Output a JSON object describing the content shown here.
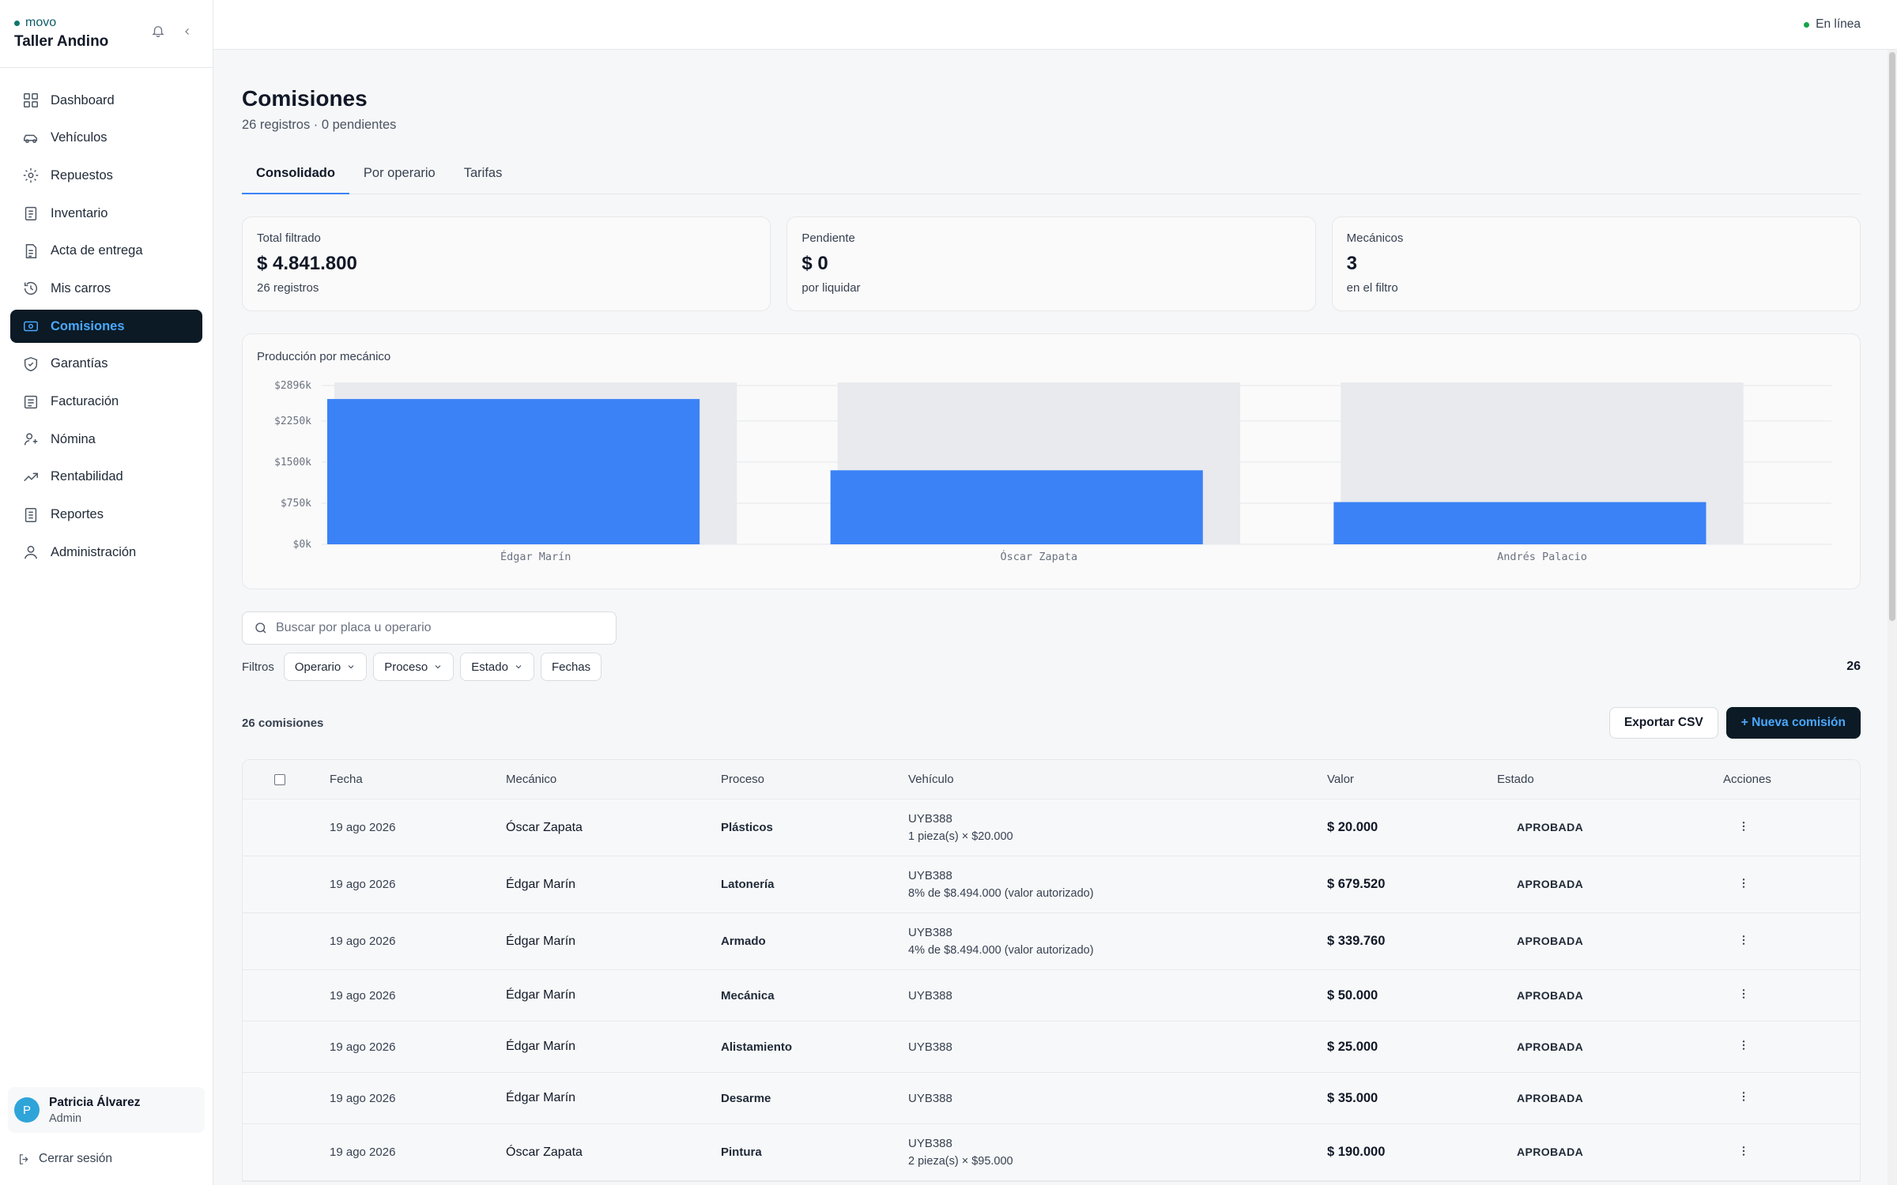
{
  "brand": {
    "small": "movo",
    "name": "Taller Andino"
  },
  "sidebar": {
    "items": [
      {
        "label": "Dashboard",
        "icon": "grid-icon"
      },
      {
        "label": "Vehículos",
        "icon": "car-icon"
      },
      {
        "label": "Repuestos",
        "icon": "gear-icon"
      },
      {
        "label": "Inventario",
        "icon": "clipboard-icon"
      },
      {
        "label": "Acta de entrega",
        "icon": "document-icon"
      },
      {
        "label": "Mis carros",
        "icon": "history-icon"
      },
      {
        "label": "Comisiones",
        "icon": "cash-icon"
      },
      {
        "label": "Garantías",
        "icon": "shield-icon"
      },
      {
        "label": "Facturación",
        "icon": "invoice-icon"
      },
      {
        "label": "Nómina",
        "icon": "user-money-icon"
      },
      {
        "label": "Rentabilidad",
        "icon": "trend-icon"
      },
      {
        "label": "Reportes",
        "icon": "report-icon"
      },
      {
        "label": "Administración",
        "icon": "admin-icon"
      }
    ],
    "active_index": 6
  },
  "user": {
    "initial": "P",
    "name": "Patricia Álvarez",
    "role": "Admin"
  },
  "logout_label": "Cerrar sesión",
  "topbar": {
    "status": "En línea"
  },
  "page": {
    "title": "Comisiones",
    "subtitle": "26 registros · 0 pendientes"
  },
  "tabs": [
    {
      "label": "Consolidado",
      "active": true
    },
    {
      "label": "Por operario",
      "active": false
    },
    {
      "label": "Tarifas",
      "active": false
    }
  ],
  "cards": [
    {
      "label": "Total filtrado",
      "value": "$ 4.841.800",
      "sub": "26 registros"
    },
    {
      "label": "Pendiente",
      "value": "$ 0",
      "sub": "por liquidar"
    },
    {
      "label": "Mecánicos",
      "value": "3",
      "sub": "en el filtro"
    }
  ],
  "chart_data": {
    "type": "bar",
    "title": "Producción por mecánico",
    "categories": [
      "Édgar Marín",
      "Óscar Zapata",
      "Andrés Palacio"
    ],
    "values": [
      2650,
      1350,
      770
    ],
    "ylim": [
      0,
      2896
    ],
    "yticks": [
      0,
      750,
      1500,
      2250,
      2896
    ],
    "ytick_labels": [
      "$0k",
      "$750k",
      "$1500k",
      "$2250k",
      "$2896k"
    ],
    "grid": true,
    "bar_color": "#3b82f6",
    "track_color": "#e8eaee"
  },
  "search": {
    "placeholder": "Buscar por placa u operario"
  },
  "filters": {
    "label": "Filtros",
    "chips": [
      "Operario",
      "Proceso",
      "Estado",
      "Fechas"
    ],
    "count": "26"
  },
  "list": {
    "count_label": "26 comisiones",
    "export_label": "Exportar CSV",
    "new_label": "+ Nueva comisión"
  },
  "table": {
    "headers": [
      "Fecha",
      "Mecánico",
      "Proceso",
      "Vehículo",
      "Valor",
      "Estado",
      "Acciones"
    ],
    "rows": [
      {
        "fecha": "19 ago 2026",
        "mecanico": "Óscar Zapata",
        "proceso": "Plásticos",
        "placa": "UYB388",
        "detalle": "1 pieza(s) × $20.000",
        "valor": "$ 20.000",
        "estado": "APROBADA"
      },
      {
        "fecha": "19 ago 2026",
        "mecanico": "Édgar Marín",
        "proceso": "Latonería",
        "placa": "UYB388",
        "detalle": "8% de $8.494.000 (valor autorizado)",
        "valor": "$ 679.520",
        "estado": "APROBADA"
      },
      {
        "fecha": "19 ago 2026",
        "mecanico": "Édgar Marín",
        "proceso": "Armado",
        "placa": "UYB388",
        "detalle": "4% de $8.494.000 (valor autorizado)",
        "valor": "$ 339.760",
        "estado": "APROBADA"
      },
      {
        "fecha": "19 ago 2026",
        "mecanico": "Édgar Marín",
        "proceso": "Mecánica",
        "placa": "UYB388",
        "detalle": "",
        "valor": "$ 50.000",
        "estado": "APROBADA"
      },
      {
        "fecha": "19 ago 2026",
        "mecanico": "Édgar Marín",
        "proceso": "Alistamiento",
        "placa": "UYB388",
        "detalle": "",
        "valor": "$ 25.000",
        "estado": "APROBADA"
      },
      {
        "fecha": "19 ago 2026",
        "mecanico": "Édgar Marín",
        "proceso": "Desarme",
        "placa": "UYB388",
        "detalle": "",
        "valor": "$ 35.000",
        "estado": "APROBADA"
      },
      {
        "fecha": "19 ago 2026",
        "mecanico": "Óscar Zapata",
        "proceso": "Pintura",
        "placa": "UYB388",
        "detalle": "2 pieza(s) × $95.000",
        "valor": "$ 190.000",
        "estado": "APROBADA"
      }
    ]
  }
}
